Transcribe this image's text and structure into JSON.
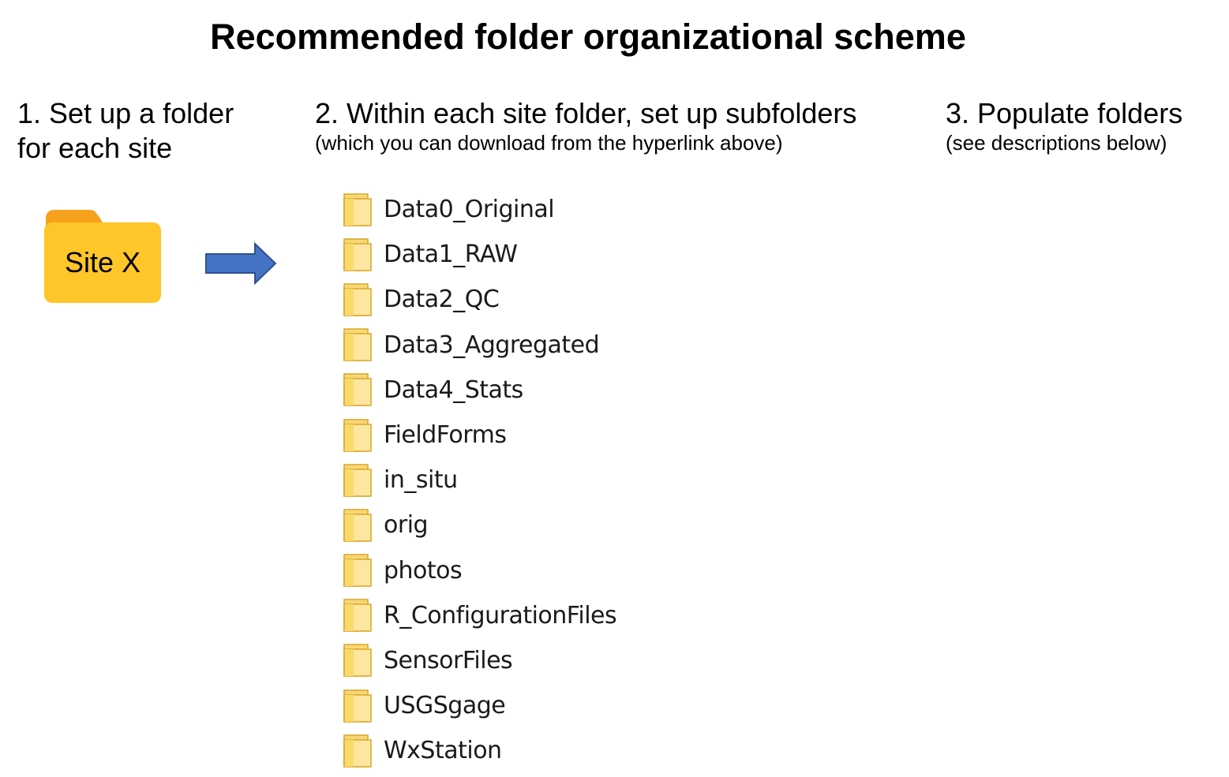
{
  "title": "Recommended folder organizational scheme",
  "steps": [
    {
      "line1": "1. Set up a folder",
      "line2": "for each site"
    },
    {
      "line1": "2. Within each site folder, set up subfolders",
      "note": "(which you can download from the hyperlink above)"
    },
    {
      "line1": "3. Populate folders",
      "note": "(see descriptions below)"
    }
  ],
  "site_folder": {
    "label": "Site X",
    "tab_color": "#f7a21c",
    "body_color": "#ffc629",
    "icon": "folder-icon"
  },
  "arrow": {
    "icon": "right-arrow-icon",
    "fill": "#4472c4",
    "stroke": "#2f528f"
  },
  "subfolders": [
    "Data0_Original",
    "Data1_RAW",
    "Data2_QC",
    "Data3_Aggregated",
    "Data4_Stats",
    "FieldForms",
    "in_situ",
    "orig",
    "photos",
    "R_ConfigurationFiles",
    "SensorFiles",
    "USGSgage",
    "WxStation"
  ]
}
